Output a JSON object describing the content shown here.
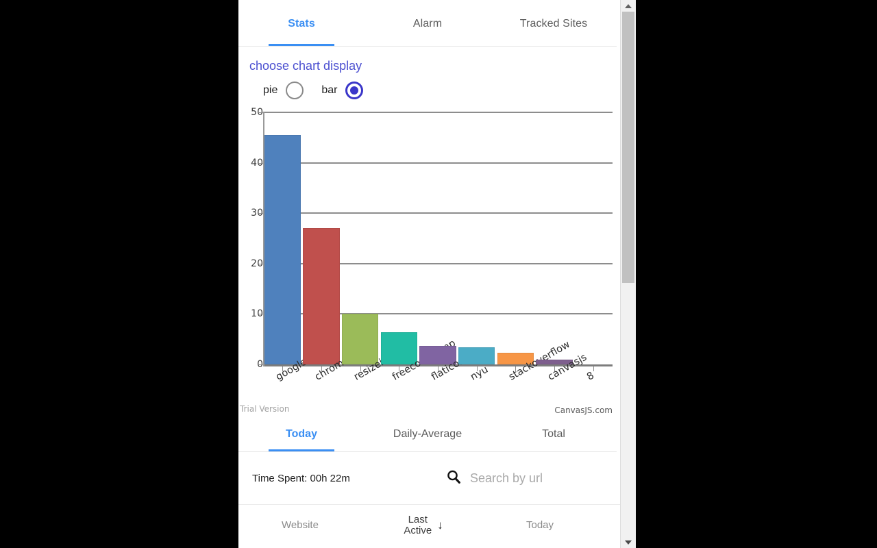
{
  "top_tabs": [
    {
      "label": "Stats",
      "active": true
    },
    {
      "label": "Alarm",
      "active": false
    },
    {
      "label": "Tracked Sites",
      "active": false
    }
  ],
  "chooser": {
    "title": "choose chart display",
    "options": [
      {
        "label": "pie",
        "selected": false
      },
      {
        "label": "bar",
        "selected": true
      }
    ]
  },
  "chart_data": {
    "type": "bar",
    "title": "",
    "xlabel": "",
    "ylabel": "",
    "ylim": [
      0,
      50
    ],
    "yticks": [
      0,
      10,
      20,
      30,
      40,
      50
    ],
    "grid": true,
    "legend": false,
    "categories": [
      "google",
      "chrome",
      "resizeimage",
      "freecodecamp",
      "flaticon",
      "nyu",
      "stackoverflow",
      "canvasjs",
      "8"
    ],
    "values": [
      45.5,
      27,
      10,
      6.4,
      3.7,
      3.4,
      2.3,
      0.9,
      0
    ],
    "colors": [
      "#4f81bd",
      "#c0504d",
      "#9bbb59",
      "#21bda4",
      "#8064a2",
      "#4bacc6",
      "#f79646",
      "#7e5f8e",
      "#2c4d75"
    ],
    "annotations": {
      "watermark_left": "Trial Version",
      "watermark_right": "CanvasJS.com"
    }
  },
  "bottom_tabs": [
    {
      "label": "Today",
      "active": true
    },
    {
      "label": "Daily-Average",
      "active": false
    },
    {
      "label": "Total",
      "active": false
    }
  ],
  "summary": {
    "time_spent": "Time Spent: 00h 22m",
    "search_placeholder": "Search by url",
    "search_value": ""
  },
  "table": {
    "columns": [
      {
        "label": "Website",
        "sorted": false
      },
      {
        "label_line1": "Last",
        "label_line2": "Active",
        "sorted": true,
        "sort_glyph": "↓"
      },
      {
        "label": "Today",
        "sorted": false
      }
    ]
  }
}
